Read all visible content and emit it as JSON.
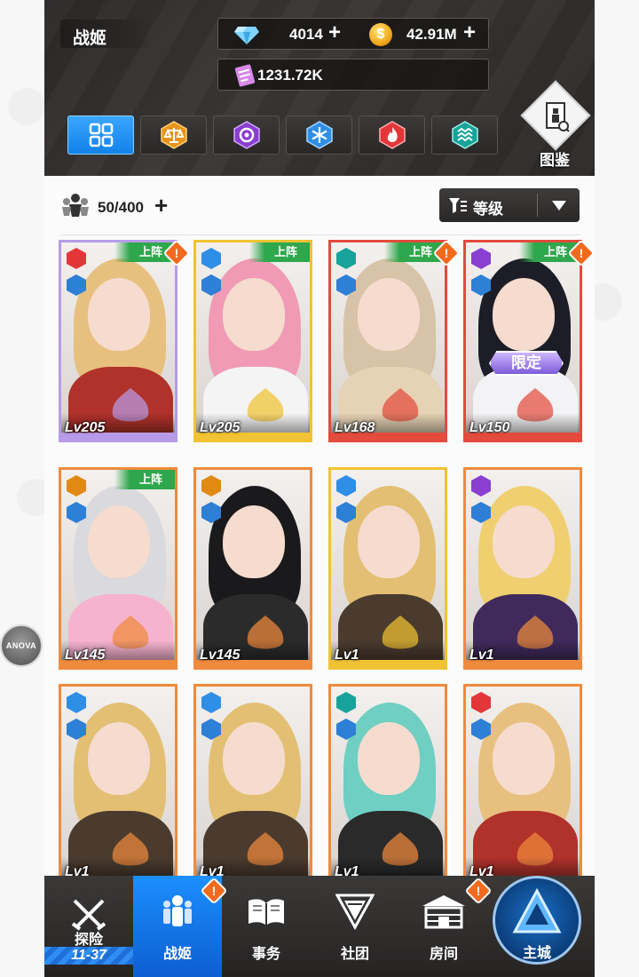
{
  "header": {
    "title": "战姬",
    "gems": "4014",
    "coins": "42.91M",
    "tickets": "1231.72K",
    "plus": "+",
    "coin_symbol": "$",
    "gallery_label": "图鉴"
  },
  "tabs": [
    {
      "name": "all",
      "icon": "grid-icon",
      "active": true
    },
    {
      "name": "balance",
      "icon": "balance-element-icon"
    },
    {
      "name": "void",
      "icon": "void-element-icon"
    },
    {
      "name": "ice",
      "icon": "ice-element-icon"
    },
    {
      "name": "fire",
      "icon": "fire-element-icon"
    },
    {
      "name": "wave",
      "icon": "wave-element-icon"
    }
  ],
  "toolbar": {
    "count": "50/400",
    "plus": "+",
    "sort_label": "等级"
  },
  "cards": [
    {
      "level": "Lv205",
      "deployed": true,
      "alert": true,
      "element": "fire",
      "rarity": "purple"
    },
    {
      "level": "Lv205",
      "deployed": true,
      "alert": false,
      "element": "ice",
      "rarity": "yellow"
    },
    {
      "level": "Lv168",
      "deployed": true,
      "alert": true,
      "element": "wave",
      "rarity": "red"
    },
    {
      "level": "Lv150",
      "deployed": true,
      "alert": true,
      "element": "void",
      "rarity": "red",
      "limited": "限定"
    },
    {
      "level": "Lv145",
      "deployed": true,
      "alert": false,
      "element": "balance",
      "rarity": "orange"
    },
    {
      "level": "Lv145",
      "deployed": false,
      "alert": false,
      "element": "balance",
      "rarity": "orange"
    },
    {
      "level": "Lv1",
      "deployed": false,
      "alert": false,
      "element": "ice",
      "rarity": "yellow"
    },
    {
      "level": "Lv1",
      "deployed": false,
      "alert": false,
      "element": "void",
      "rarity": "orange"
    },
    {
      "level": "Lv1",
      "deployed": false,
      "alert": false,
      "element": "ice",
      "rarity": "orange"
    },
    {
      "level": "Lv1",
      "deployed": false,
      "alert": false,
      "element": "ice",
      "rarity": "orange"
    },
    {
      "level": "Lv1",
      "deployed": false,
      "alert": false,
      "element": "wave",
      "rarity": "orange"
    },
    {
      "level": "Lv1",
      "deployed": false,
      "alert": false,
      "element": "fire",
      "rarity": "orange"
    }
  ],
  "deploy_label": "上阵",
  "alert_mark": "!",
  "side_avatar_label": "ANOVA",
  "nav": {
    "explore": "探险",
    "explore_stage": "11-37",
    "girls": "战姬",
    "affairs": "事务",
    "club": "社团",
    "room": "房间",
    "home": "主城"
  },
  "colors": {
    "accent_blue": "#1282e9",
    "deploy_green": "#2fa74c",
    "alert_orange": "#f26a1e",
    "fire": "#e3363a",
    "ice": "#2f8ee6",
    "wave": "#18a39a",
    "void": "#8a3fd0",
    "balance": "#e08a15"
  }
}
